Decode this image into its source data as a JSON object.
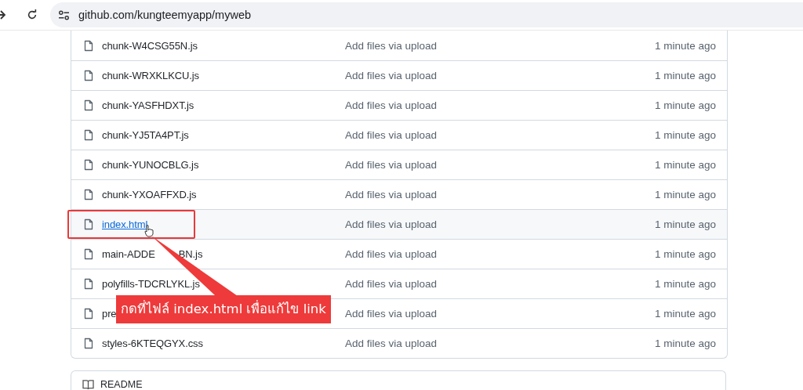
{
  "browser": {
    "url": "github.com/kungteemyapp/myweb"
  },
  "files": [
    {
      "name": "chunk-W4CSG55N.js",
      "message": "Add files via upload",
      "time": "1 minute ago",
      "highlighted": false
    },
    {
      "name": "chunk-WRXKLKCU.js",
      "message": "Add files via upload",
      "time": "1 minute ago",
      "highlighted": false
    },
    {
      "name": "chunk-YASFHDXT.js",
      "message": "Add files via upload",
      "time": "1 minute ago",
      "highlighted": false
    },
    {
      "name": "chunk-YJ5TA4PT.js",
      "message": "Add files via upload",
      "time": "1 minute ago",
      "highlighted": false
    },
    {
      "name": "chunk-YUNOCBLG.js",
      "message": "Add files via upload",
      "time": "1 minute ago",
      "highlighted": false
    },
    {
      "name": "chunk-YXOAFFXD.js",
      "message": "Add files via upload",
      "time": "1 minute ago",
      "highlighted": false
    },
    {
      "name": "index.html",
      "message": "Add files via upload",
      "time": "1 minute ago",
      "highlighted": true
    },
    {
      "name": "main-ADDE",
      "name_after_cover": "BN.js",
      "message": "Add files via upload",
      "time": "1 minute ago",
      "highlighted": false
    },
    {
      "name": "polyfills-TDCRLYKL.js",
      "message": "Add files via upload",
      "time": "1 minute ago",
      "highlighted": false
    },
    {
      "name": "pre",
      "message": "Add files via upload",
      "time": "1 minute ago",
      "highlighted": false
    },
    {
      "name": "styles-6KTEQGYX.css",
      "message": "Add files via upload",
      "time": "1 minute ago",
      "highlighted": false
    }
  ],
  "callout": {
    "text": "กดที่ไฟล์ index.html เพื่อแก้ไข link"
  },
  "readme": {
    "title": "README"
  }
}
